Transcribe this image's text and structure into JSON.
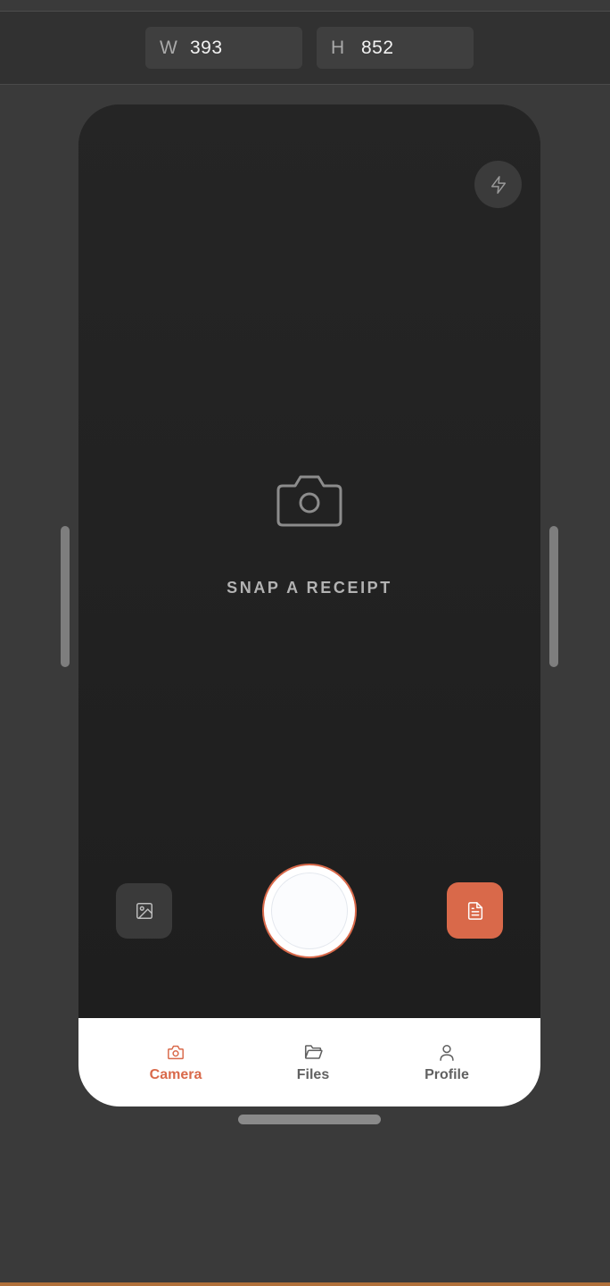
{
  "toolbar": {
    "width_label": "W",
    "width_value": "393",
    "height_label": "H",
    "height_value": "852"
  },
  "viewfinder": {
    "flash_icon": "lightning-icon",
    "hero_icon": "camera-icon",
    "prompt": "SNAP A RECEIPT",
    "gallery_icon": "image-icon",
    "document_icon": "document-icon"
  },
  "tabs": [
    {
      "label": "Camera",
      "icon": "camera-icon",
      "active": true
    },
    {
      "label": "Files",
      "icon": "folder-icon",
      "active": false
    },
    {
      "label": "Profile",
      "icon": "user-icon",
      "active": false
    }
  ],
  "colors": {
    "accent": "#d9694a",
    "viewfinder_bg": "#222222",
    "tabbar_bg": "#ffffff",
    "inactive_tab": "#616161"
  }
}
